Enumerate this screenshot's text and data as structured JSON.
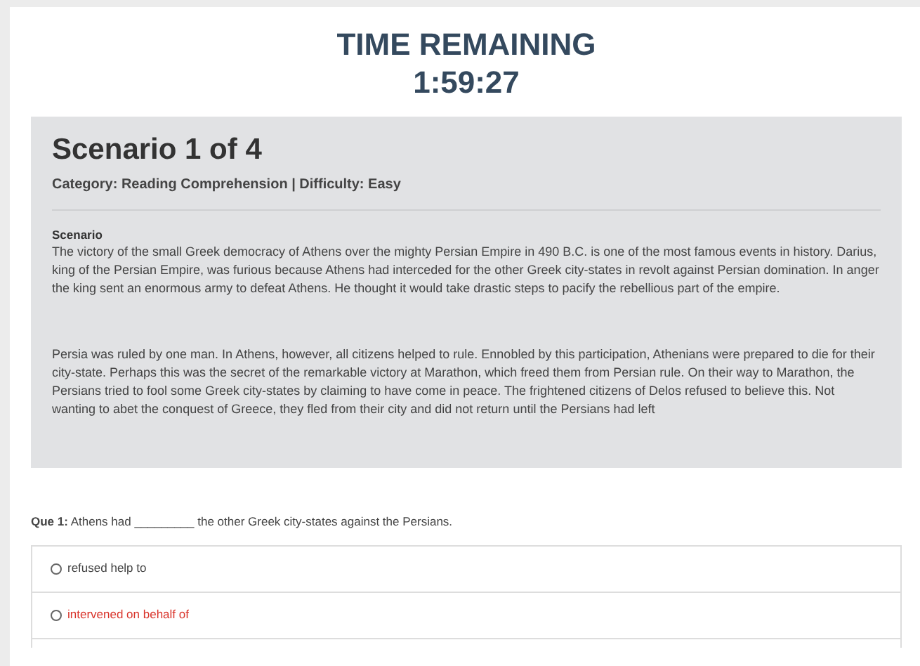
{
  "timer": {
    "label": "TIME REMAINING",
    "value": "1:59:27"
  },
  "scenario": {
    "title": "Scenario 1 of 4",
    "meta": "Category: Reading Comprehension | Difficulty: Easy",
    "heading": "Scenario",
    "paragraphs": [
      "The victory of the small Greek democracy of Athens over the mighty Persian Empire in 490 B.C. is one of the most famous events in history. Darius, king of the Persian Empire, was furious because Athens had interceded for the other Greek city-states in revolt against Persian domination. In anger the king sent an enormous army to defeat Athens. He thought it would take drastic steps to pacify the rebellious part of the empire.",
      "Persia was ruled by one man. In Athens, however, all citizens helped to rule. Ennobled by this participation, Athenians were prepared to die for their city-state. Perhaps this was the secret of the remarkable victory at Marathon, which freed them from Persian rule. On their way to Marathon, the Persians tried to fool some Greek city-states by claiming to have come in peace. The frightened citizens of Delos refused to believe this. Not wanting to abet the conquest of Greece, they fled from their city and did not return until the Persians had left"
    ]
  },
  "question": {
    "text": "**Que 1:** Athens had _________ the other Greek city-states against the Persians.",
    "options": [
      {
        "label": "refused help to",
        "highlighted": false,
        "checked": false
      },
      {
        "label": "intervened on behalf of",
        "highlighted": true,
        "checked": false
      }
    ]
  }
}
